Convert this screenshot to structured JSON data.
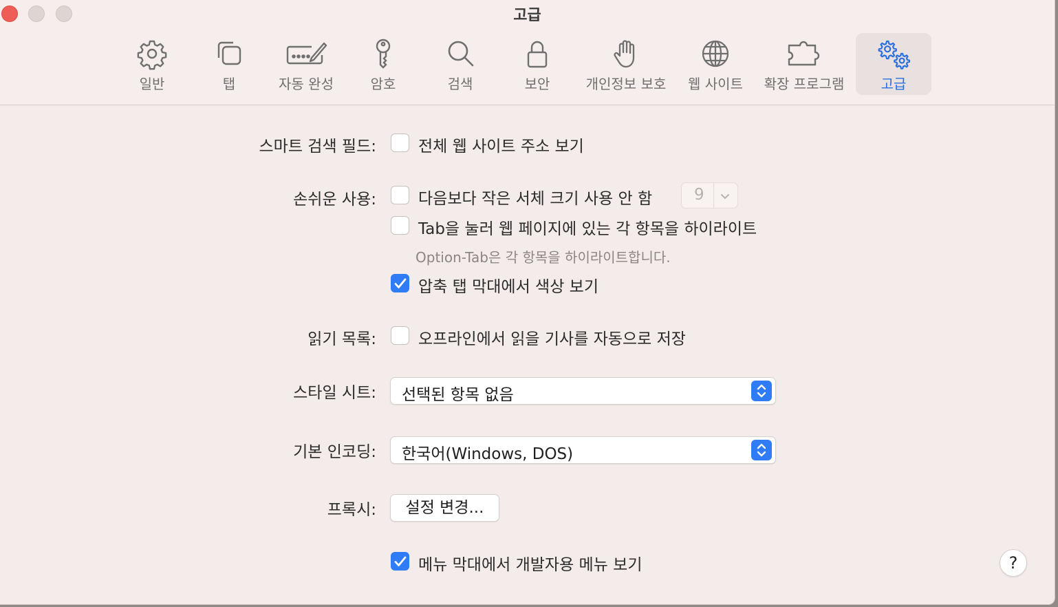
{
  "window": {
    "title": "고급",
    "accent_color": "#2f7cf6"
  },
  "toolbar": {
    "tabs": [
      {
        "label": "일반",
        "icon": "gear-icon"
      },
      {
        "label": "탭",
        "icon": "tabs-icon"
      },
      {
        "label": "자동 완성",
        "icon": "autofill-icon"
      },
      {
        "label": "암호",
        "icon": "key-icon"
      },
      {
        "label": "검색",
        "icon": "search-icon"
      },
      {
        "label": "보안",
        "icon": "lock-icon"
      },
      {
        "label": "개인정보 보호",
        "icon": "hand-icon"
      },
      {
        "label": "웹 사이트",
        "icon": "globe-icon"
      },
      {
        "label": "확장 프로그램",
        "icon": "puzzle-icon"
      },
      {
        "label": "고급",
        "icon": "gears-icon",
        "selected": true
      }
    ]
  },
  "settings": {
    "smart_search": {
      "label": "스마트 검색 필드:",
      "show_full_address": {
        "text": "전체 웹 사이트 주소 보기",
        "checked": false
      }
    },
    "accessibility": {
      "label": "손쉬운 사용:",
      "min_font": {
        "text": "다음보다 작은 서체 크기 사용 안 함",
        "checked": false,
        "value": "9"
      },
      "tab_highlight": {
        "text": "Tab을 눌러 웹 페이지에 있는 각 항목을 하이라이트",
        "checked": false
      },
      "hint": "Option-Tab은 각 항목을 하이라이트합니다.",
      "compact_color": {
        "text": "압축 탭 막대에서 색상 보기",
        "checked": true
      }
    },
    "reading_list": {
      "label": "읽기 목록:",
      "save_offline": {
        "text": "오프라인에서 읽을 기사를 자동으로 저장",
        "checked": false
      }
    },
    "style_sheet": {
      "label": "스타일 시트:",
      "value": "선택된 항목 없음"
    },
    "encoding": {
      "label": "기본 인코딩:",
      "value": "한국어(Windows, DOS)"
    },
    "proxies": {
      "label": "프록시:",
      "button": "설정 변경..."
    },
    "develop_menu": {
      "text": "메뉴 막대에서 개발자용 메뉴 보기",
      "checked": true
    }
  },
  "help": {
    "label": "?"
  }
}
